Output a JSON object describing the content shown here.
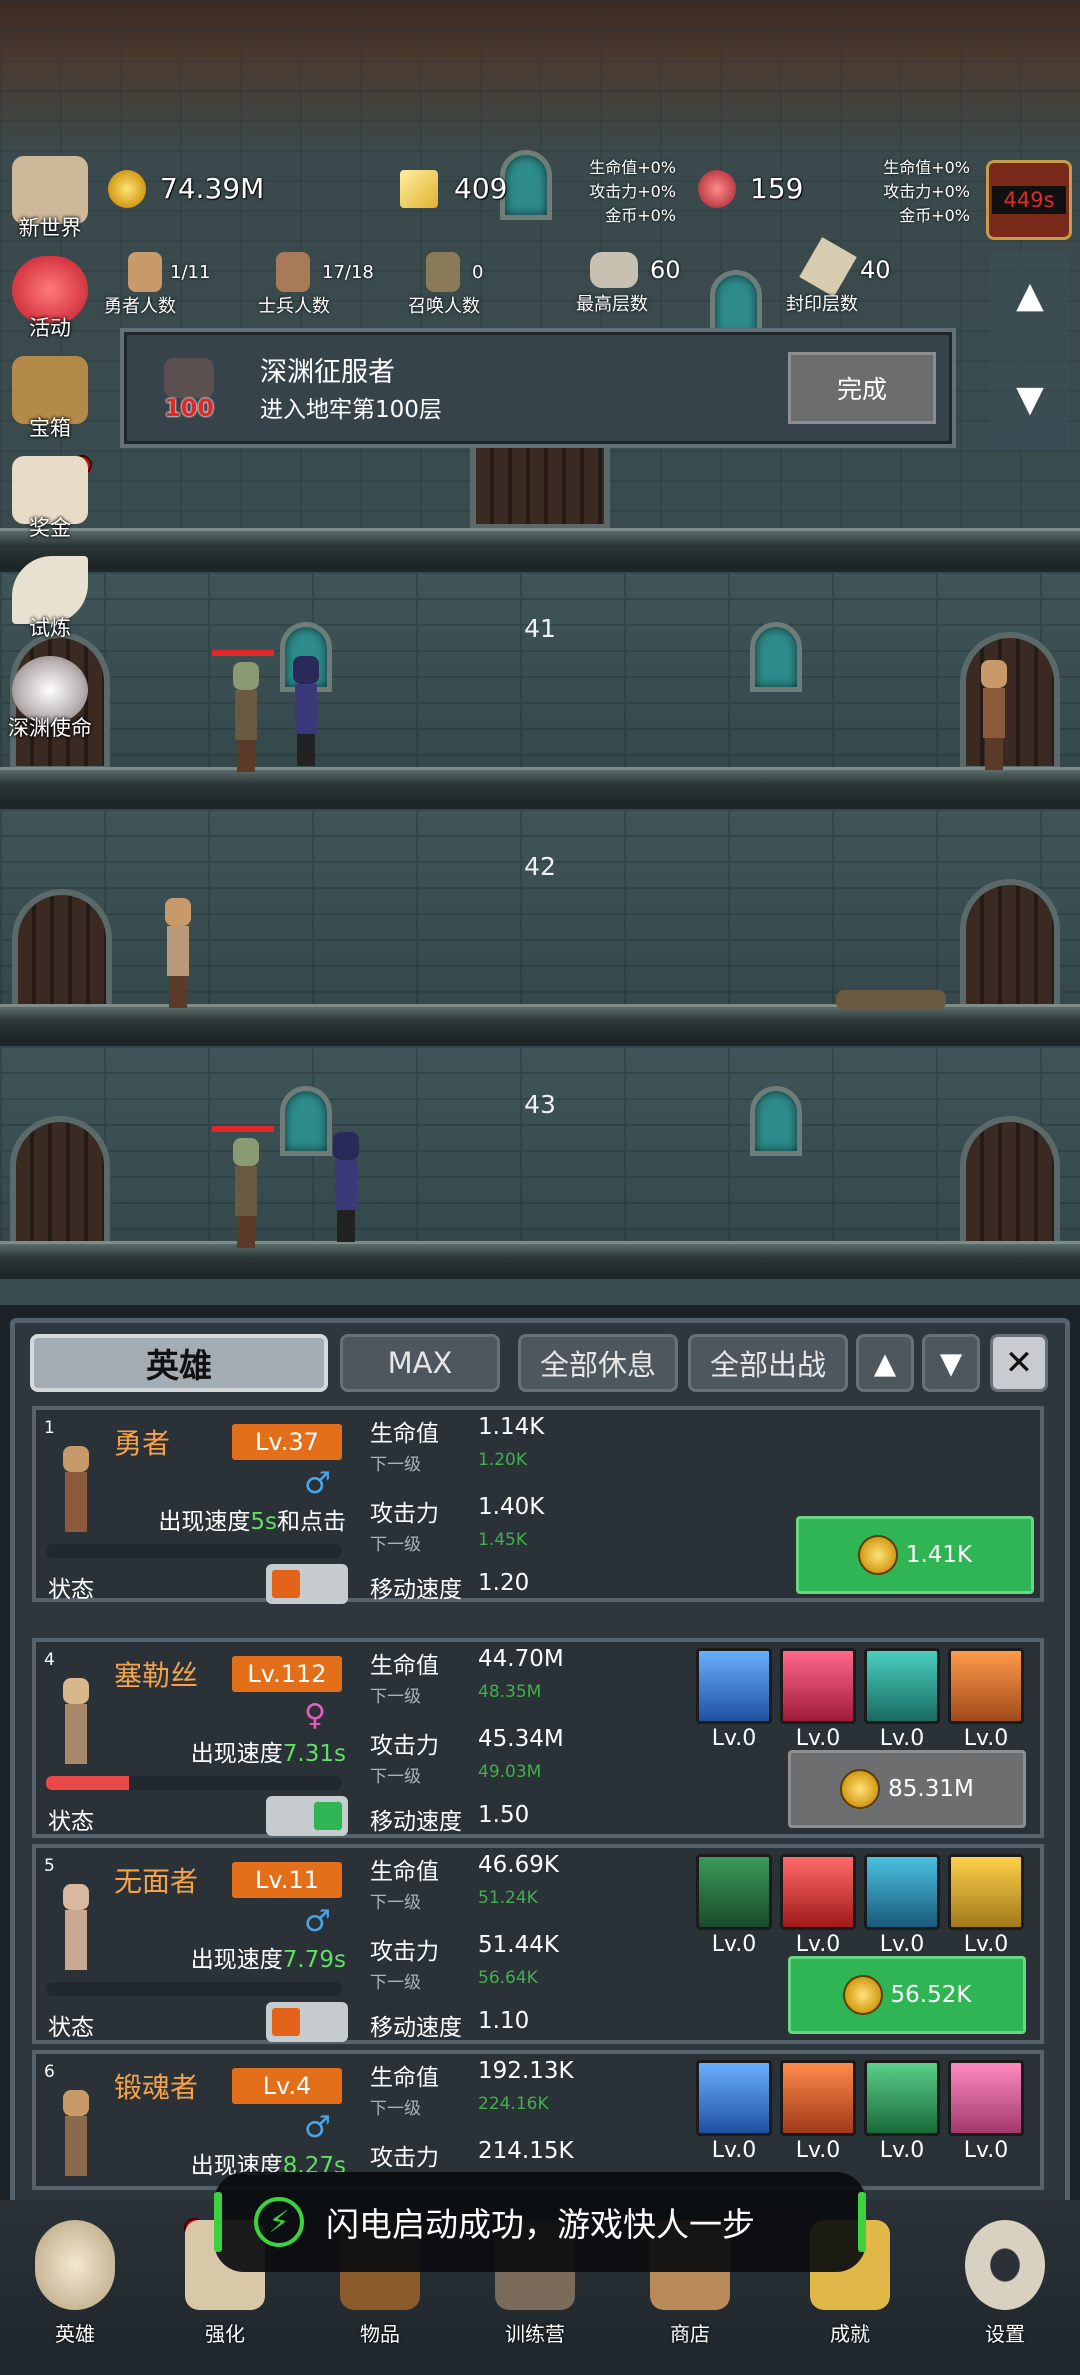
{
  "sidebar": {
    "items": [
      {
        "label": "新世界",
        "icon": "map-icon"
      },
      {
        "label": "活动",
        "icon": "heart-icon"
      },
      {
        "label": "宝箱",
        "icon": "chest-icon"
      },
      {
        "label": "奖金",
        "icon": "letter-icon"
      },
      {
        "label": "试炼",
        "icon": "feather-icon"
      },
      {
        "label": "深渊使命",
        "icon": "orb-icon"
      }
    ]
  },
  "resources": {
    "gold": "74.39M",
    "gold_bar": "409",
    "gem": "159"
  },
  "buffs_left": {
    "hp": "生命值+0%",
    "atk": "攻击力+0%",
    "gold": "金币+0%"
  },
  "buffs_right": {
    "hp": "生命值+0%",
    "atk": "攻击力+0%",
    "gold": "金币+0%"
  },
  "timer": "449s",
  "stats": {
    "heroes": {
      "value": "1/11",
      "label": "勇者人数"
    },
    "soldiers": {
      "value": "17/18",
      "label": "士兵人数"
    },
    "summons": {
      "value": "0",
      "label": "召唤人数"
    },
    "max_floor": {
      "value": "60",
      "label": "最高层数"
    },
    "seal_floor": {
      "value": "40",
      "label": "封印层数"
    }
  },
  "quest": {
    "title": "深渊征服者",
    "subtitle": "进入地牢第100层",
    "badge": "100",
    "button": "完成"
  },
  "floors": [
    "41",
    "42",
    "43"
  ],
  "panel": {
    "tab_hero": "英雄",
    "tab_max": "MAX",
    "tab_rest": "全部休息",
    "tab_fight": "全部出战"
  },
  "heroes": [
    {
      "rank": "1",
      "name": "勇者",
      "level": "Lv.37",
      "gender": "♂",
      "appear_prefix": "出现速度",
      "appear_value": "5s",
      "appear_suffix": "和点击",
      "state_label": "状态",
      "state_on": false,
      "hp_fraction": 0,
      "hp_label": "生命值",
      "hp": "1.14K",
      "next_label": "下一级",
      "hp_next": "1.20K",
      "atk_label": "攻击力",
      "atk": "1.40K",
      "atk_next": "1.45K",
      "spd_label": "移动速度",
      "spd": "1.20",
      "price": "1.41K",
      "price_style": "green"
    },
    {
      "rank": "4",
      "name": "塞勒丝",
      "level": "Lv.112",
      "gender": "♀",
      "appear_prefix": "出现速度",
      "appear_value": "7.31s",
      "appear_suffix": "",
      "state_label": "状态",
      "state_on": true,
      "hp_fraction": 0.28,
      "hp_label": "生命值",
      "hp": "44.70M",
      "next_label": "下一级",
      "hp_next": "48.35M",
      "atk_label": "攻击力",
      "atk": "45.34M",
      "atk_next": "49.03M",
      "spd_label": "移动速度",
      "spd": "1.50",
      "price": "85.31M",
      "price_style": "gray",
      "skills": [
        "Lv.0",
        "Lv.0",
        "Lv.0",
        "Lv.0"
      ]
    },
    {
      "rank": "5",
      "name": "无面者",
      "level": "Lv.11",
      "gender": "♂",
      "appear_prefix": "出现速度",
      "appear_value": "7.79s",
      "appear_suffix": "",
      "state_label": "状态",
      "state_on": false,
      "hp_fraction": 0,
      "hp_label": "生命值",
      "hp": "46.69K",
      "next_label": "下一级",
      "hp_next": "51.24K",
      "atk_label": "攻击力",
      "atk": "51.44K",
      "atk_next": "56.64K",
      "spd_label": "移动速度",
      "spd": "1.10",
      "price": "56.52K",
      "price_style": "green",
      "skills": [
        "Lv.0",
        "Lv.0",
        "Lv.0",
        "Lv.0"
      ]
    },
    {
      "rank": "6",
      "name": "锻魂者",
      "level": "Lv.4",
      "gender": "♂",
      "appear_prefix": "出现速度",
      "appear_value": "8.27s",
      "appear_suffix": "",
      "hp_label": "生命值",
      "hp": "192.13K",
      "next_label": "下一级",
      "hp_next": "224.16K",
      "atk_label": "攻击力",
      "atk": "214.15K",
      "skills": [
        "Lv.0",
        "Lv.0",
        "Lv.0",
        "Lv.0"
      ]
    }
  ],
  "toast": "闪电启动成功，游戏快人一步",
  "nav": [
    {
      "label": "英雄",
      "icon": "skull-icon"
    },
    {
      "label": "强化",
      "icon": "upgrade-icon"
    },
    {
      "label": "物品",
      "icon": "book-icon"
    },
    {
      "label": "训练营",
      "icon": "training-icon"
    },
    {
      "label": "商店",
      "icon": "shop-icon"
    },
    {
      "label": "成就",
      "icon": "key-icon"
    },
    {
      "label": "设置",
      "icon": "gear-icon"
    }
  ],
  "colors": {
    "accent_orange": "#e46f1a",
    "green": "#2fb553",
    "panel": "#2e373e",
    "name": "#f6a24a"
  }
}
